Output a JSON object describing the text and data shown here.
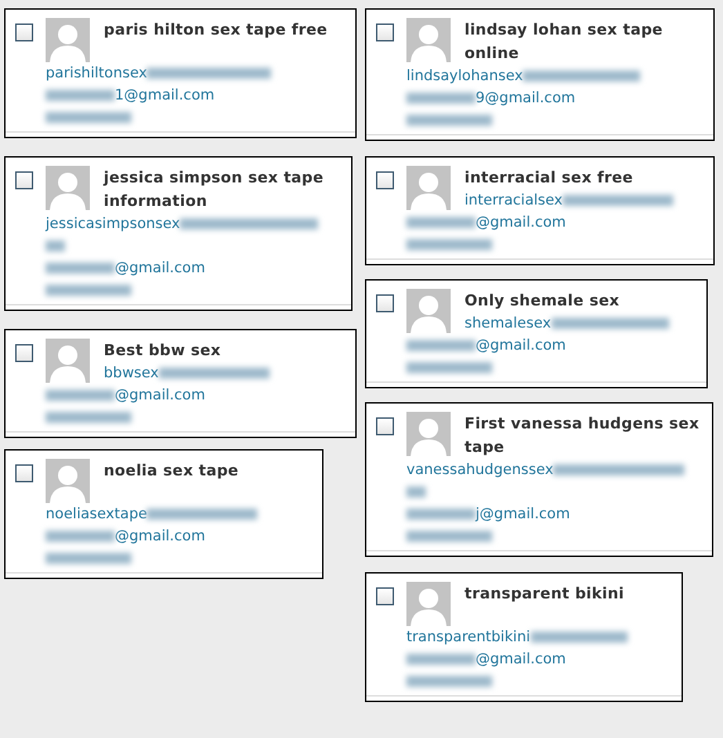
{
  "columns": [
    {
      "comments": [
        {
          "selected": false,
          "title": "paris hilton sex tape free",
          "url": "parishiltonsex",
          "email": "1@gmail.com"
        },
        {
          "selected": false,
          "title": "jessica simpson sex tape information",
          "url": "jessicasimpsonsex",
          "email": "@gmail.com"
        },
        {
          "selected": false,
          "title": "Best bbw sex",
          "url": "bbwsex",
          "email": "@gmail.com"
        },
        {
          "selected": false,
          "title": "noelia sex tape",
          "url": "noeliasextape",
          "email": "@gmail.com"
        }
      ]
    },
    {
      "comments": [
        {
          "selected": false,
          "title": "lindsay lohan sex tape online",
          "url": "lindsaylohansex",
          "email": "9@gmail.com"
        },
        {
          "selected": false,
          "title": "interracial sex free",
          "url": "interracialsex",
          "email": "@gmail.com"
        },
        {
          "selected": false,
          "title": "Only shemale sex",
          "url": "shemalesex",
          "email": "@gmail.com"
        },
        {
          "selected": false,
          "title": "First vanessa hudgens sex tape",
          "url": "vanessahudgenssex",
          "email": "j@gmail.com"
        },
        {
          "selected": false,
          "title": "transparent bikini",
          "url": "transparentbikini",
          "email": "@gmail.com"
        }
      ]
    }
  ]
}
